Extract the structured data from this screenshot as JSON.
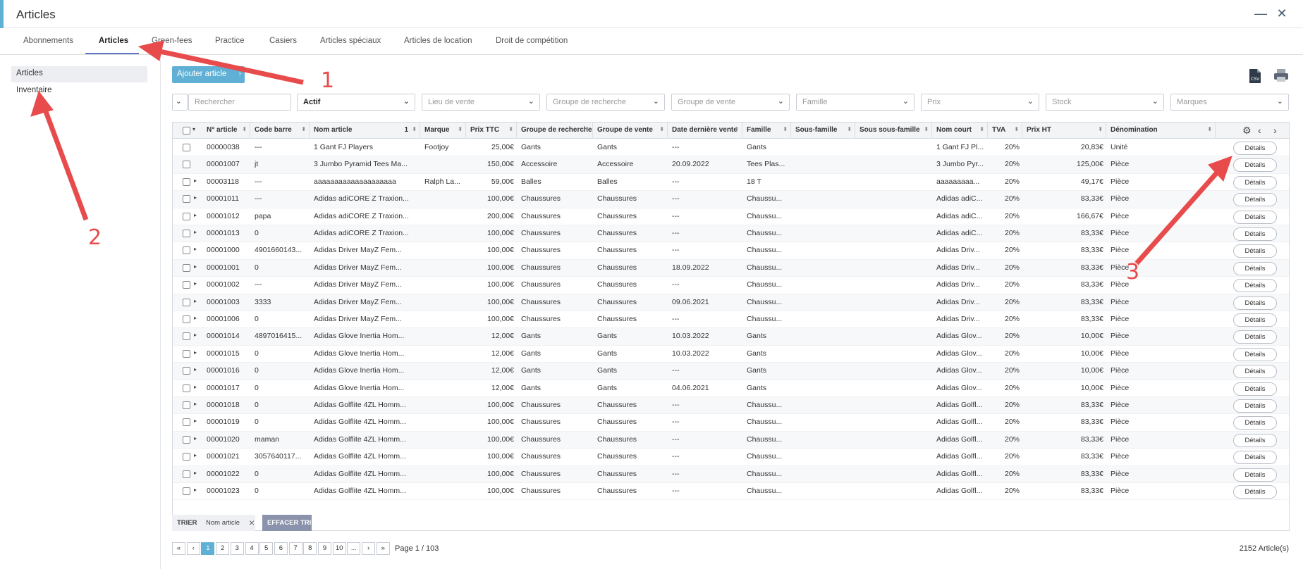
{
  "window": {
    "title": "Articles",
    "minimize": "—",
    "close": "✕"
  },
  "tabs": [
    "Abonnements",
    "Articles",
    "Green-fees",
    "Practice",
    "Casiers",
    "Articles spéciaux",
    "Articles de location",
    "Droit de compétition"
  ],
  "sidebar": {
    "items": [
      "Articles",
      "Inventaire"
    ]
  },
  "toolbar": {
    "add_label": "Ajouter article",
    "csv_icon": "csv-export-icon",
    "print_icon": "printer-icon"
  },
  "filters": {
    "search_placeholder": "Rechercher",
    "status": "Actif",
    "lieu": "Lieu de vente",
    "groupe_recherche": "Groupe de recherche",
    "groupe_vente": "Groupe de vente",
    "famille": "Famille",
    "prix": "Prix",
    "stock": "Stock",
    "marques": "Marques"
  },
  "columns": [
    "N° article",
    "Code barre",
    "Nom article",
    "Marque",
    "Prix TTC",
    "Groupe de recherche",
    "Groupe de vente",
    "Date dernière vente",
    "Famille",
    "Sous-famille",
    "Sous sous-famille",
    "Nom court",
    "TVA",
    "Prix HT",
    "Dénomination"
  ],
  "sort_indicator": "1",
  "details_label": "Détails",
  "rows": [
    [
      "00000038",
      "---",
      "1 Gant FJ Players",
      "Footjoy",
      "25,00€",
      "Gants",
      "Gants",
      "---",
      "Gants",
      "",
      "",
      "1 Gant FJ Pl...",
      "20%",
      "20,83€",
      "Unité"
    ],
    [
      "00001007",
      "jt",
      "3 Jumbo Pyramid Tees Ma...",
      "",
      "150,00€",
      "Accessoire",
      "Accessoire",
      "20.09.2022",
      "Tees Plas...",
      "",
      "",
      "3 Jumbo Pyr...",
      "20%",
      "125,00€",
      "Pièce"
    ],
    [
      "00003118",
      "---",
      "aaaaaaaaaaaaaaaaaaaa",
      "Ralph La...",
      "59,00€",
      "Balles",
      "Balles",
      "---",
      "18 T",
      "",
      "",
      "aaaaaaaaa...",
      "20%",
      "49,17€",
      "Pièce"
    ],
    [
      "00001011",
      "---",
      "Adidas adiCORE Z Traxion...",
      "",
      "100,00€",
      "Chaussures",
      "Chaussures",
      "---",
      "Chaussu...",
      "",
      "",
      "Adidas adiC...",
      "20%",
      "83,33€",
      "Pièce"
    ],
    [
      "00001012",
      "papa",
      "Adidas adiCORE Z Traxion...",
      "",
      "200,00€",
      "Chaussures",
      "Chaussures",
      "---",
      "Chaussu...",
      "",
      "",
      "Adidas adiC...",
      "20%",
      "166,67€",
      "Pièce"
    ],
    [
      "00001013",
      "0",
      "Adidas adiCORE Z Traxion...",
      "",
      "100,00€",
      "Chaussures",
      "Chaussures",
      "---",
      "Chaussu...",
      "",
      "",
      "Adidas adiC...",
      "20%",
      "83,33€",
      "Pièce"
    ],
    [
      "00001000",
      "4901660143...",
      "Adidas Driver MayZ Fem...",
      "",
      "100,00€",
      "Chaussures",
      "Chaussures",
      "---",
      "Chaussu...",
      "",
      "",
      "Adidas Driv...",
      "20%",
      "83,33€",
      "Pièce"
    ],
    [
      "00001001",
      "0",
      "Adidas Driver MayZ Fem...",
      "",
      "100,00€",
      "Chaussures",
      "Chaussures",
      "18.09.2022",
      "Chaussu...",
      "",
      "",
      "Adidas Driv...",
      "20%",
      "83,33€",
      "Pièce"
    ],
    [
      "00001002",
      "---",
      "Adidas Driver MayZ Fem...",
      "",
      "100,00€",
      "Chaussures",
      "Chaussures",
      "---",
      "Chaussu...",
      "",
      "",
      "Adidas Driv...",
      "20%",
      "83,33€",
      "Pièce"
    ],
    [
      "00001003",
      "3333",
      "Adidas Driver MayZ Fem...",
      "",
      "100,00€",
      "Chaussures",
      "Chaussures",
      "09.06.2021",
      "Chaussu...",
      "",
      "",
      "Adidas Driv...",
      "20%",
      "83,33€",
      "Pièce"
    ],
    [
      "00001006",
      "0",
      "Adidas Driver MayZ Fem...",
      "",
      "100,00€",
      "Chaussures",
      "Chaussures",
      "---",
      "Chaussu...",
      "",
      "",
      "Adidas Driv...",
      "20%",
      "83,33€",
      "Pièce"
    ],
    [
      "00001014",
      "4897016415...",
      "Adidas Glove Inertia Hom...",
      "",
      "12,00€",
      "Gants",
      "Gants",
      "10.03.2022",
      "Gants",
      "",
      "",
      "Adidas Glov...",
      "20%",
      "10,00€",
      "Pièce"
    ],
    [
      "00001015",
      "0",
      "Adidas Glove Inertia Hom...",
      "",
      "12,00€",
      "Gants",
      "Gants",
      "10.03.2022",
      "Gants",
      "",
      "",
      "Adidas Glov...",
      "20%",
      "10,00€",
      "Pièce"
    ],
    [
      "00001016",
      "0",
      "Adidas Glove Inertia Hom...",
      "",
      "12,00€",
      "Gants",
      "Gants",
      "---",
      "Gants",
      "",
      "",
      "Adidas Glov...",
      "20%",
      "10,00€",
      "Pièce"
    ],
    [
      "00001017",
      "0",
      "Adidas Glove Inertia Hom...",
      "",
      "12,00€",
      "Gants",
      "Gants",
      "04.06.2021",
      "Gants",
      "",
      "",
      "Adidas Glov...",
      "20%",
      "10,00€",
      "Pièce"
    ],
    [
      "00001018",
      "0",
      "Adidas Golflite 4ZL Homm...",
      "",
      "100,00€",
      "Chaussures",
      "Chaussures",
      "---",
      "Chaussu...",
      "",
      "",
      "Adidas Golfl...",
      "20%",
      "83,33€",
      "Pièce"
    ],
    [
      "00001019",
      "0",
      "Adidas Golflite 4ZL Homm...",
      "",
      "100,00€",
      "Chaussures",
      "Chaussures",
      "---",
      "Chaussu...",
      "",
      "",
      "Adidas Golfl...",
      "20%",
      "83,33€",
      "Pièce"
    ],
    [
      "00001020",
      "maman",
      "Adidas Golflite 4ZL Homm...",
      "",
      "100,00€",
      "Chaussures",
      "Chaussures",
      "---",
      "Chaussu...",
      "",
      "",
      "Adidas Golfl...",
      "20%",
      "83,33€",
      "Pièce"
    ],
    [
      "00001021",
      "3057640117...",
      "Adidas Golflite 4ZL Homm...",
      "",
      "100,00€",
      "Chaussures",
      "Chaussures",
      "---",
      "Chaussu...",
      "",
      "",
      "Adidas Golfl...",
      "20%",
      "83,33€",
      "Pièce"
    ],
    [
      "00001022",
      "0",
      "Adidas Golflite 4ZL Homm...",
      "",
      "100,00€",
      "Chaussures",
      "Chaussures",
      "---",
      "Chaussu...",
      "",
      "",
      "Adidas Golfl...",
      "20%",
      "83,33€",
      "Pièce"
    ],
    [
      "00001023",
      "0",
      "Adidas Golflite 4ZL Homm...",
      "",
      "100,00€",
      "Chaussures",
      "Chaussures",
      "---",
      "Chaussu...",
      "",
      "",
      "Adidas Golfl...",
      "20%",
      "83,33€",
      "Pièce"
    ]
  ],
  "sortbar": {
    "label": "TRIER",
    "field": "Nom article",
    "clear": "EFFACER TRI"
  },
  "pagination": {
    "first": "«",
    "prev": "‹",
    "pages": [
      "1",
      "2",
      "3",
      "4",
      "5",
      "6",
      "7",
      "8",
      "9",
      "10",
      "..."
    ],
    "next": "›",
    "last": "»",
    "info": "Page 1 / 103",
    "total": "2152 Article(s)"
  },
  "annotations": [
    "1",
    "2",
    "3"
  ],
  "colors": {
    "accent": "#5fb0d4",
    "tab_underline": "#6277c2",
    "clear_button": "#8a93ab",
    "annotation": "#e84b4b"
  }
}
